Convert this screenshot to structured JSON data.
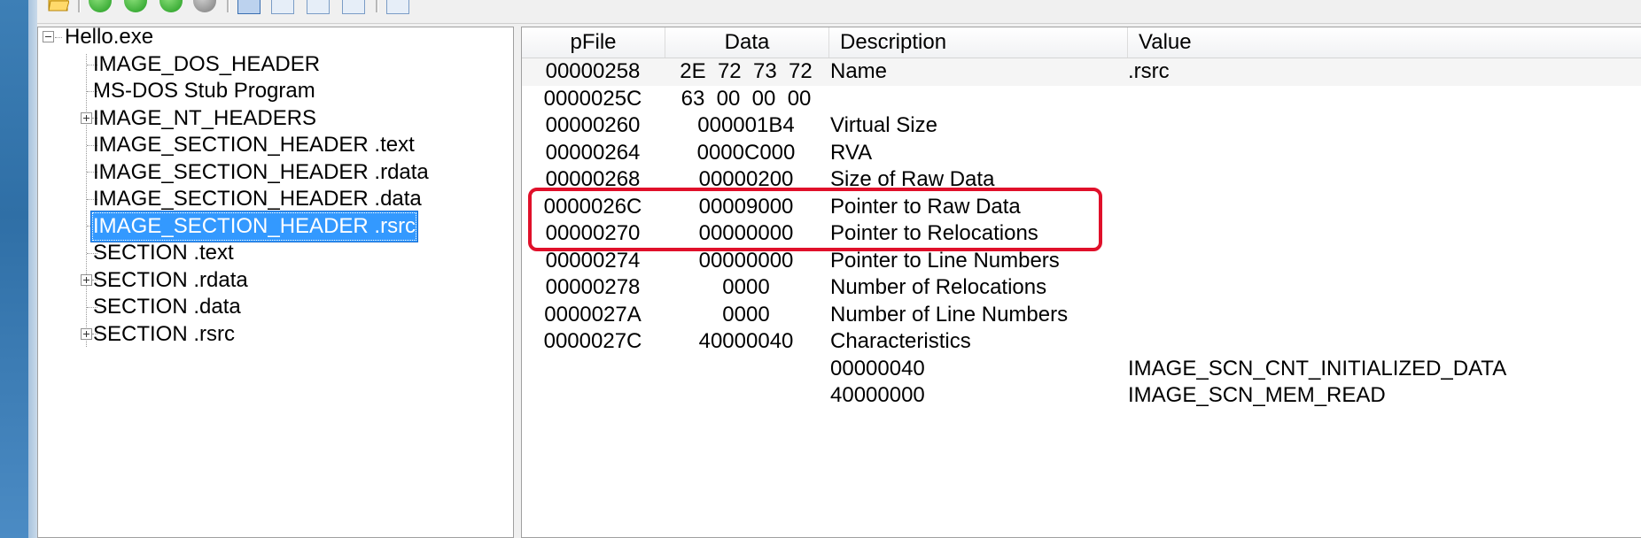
{
  "colors": {
    "accent_selection": "#3399ff",
    "highlight_border": "#e0102a"
  },
  "toolbar": {
    "icons": [
      "folder-open-icon",
      "green-go-icon",
      "green-forward-icon",
      "green-back-icon",
      "gray-stop-icon",
      "view-box-icon",
      "view-box-icon",
      "view-box-icon",
      "view-box-icon",
      "view-box-icon"
    ]
  },
  "tree": {
    "root": "Hello.exe",
    "items": [
      {
        "label": "IMAGE_DOS_HEADER",
        "expandable": false
      },
      {
        "label": "MS-DOS Stub Program",
        "expandable": false
      },
      {
        "label": "IMAGE_NT_HEADERS",
        "expandable": true
      },
      {
        "label": "IMAGE_SECTION_HEADER .text",
        "expandable": false
      },
      {
        "label": "IMAGE_SECTION_HEADER .rdata",
        "expandable": false
      },
      {
        "label": "IMAGE_SECTION_HEADER .data",
        "expandable": false
      },
      {
        "label": "IMAGE_SECTION_HEADER .rsrc",
        "expandable": false,
        "selected": true
      },
      {
        "label": "SECTION .text",
        "expandable": false
      },
      {
        "label": "SECTION .rdata",
        "expandable": true
      },
      {
        "label": "SECTION .data",
        "expandable": false
      },
      {
        "label": "SECTION .rsrc",
        "expandable": true
      }
    ]
  },
  "list": {
    "columns": [
      "pFile",
      "Data",
      "Description",
      "Value"
    ],
    "rows": [
      {
        "pfile": "00000258",
        "data": "2E  72  73  72",
        "desc": "Name",
        "value": ".rsrc"
      },
      {
        "pfile": "0000025C",
        "data": "63  00  00  00",
        "desc": "",
        "value": ""
      },
      {
        "pfile": "00000260",
        "data": "000001B4",
        "desc": "Virtual Size",
        "value": ""
      },
      {
        "pfile": "00000264",
        "data": "0000C000",
        "desc": "RVA",
        "value": ""
      },
      {
        "pfile": "00000268",
        "data": "00000200",
        "desc": "Size of Raw Data",
        "value": ""
      },
      {
        "pfile": "0000026C",
        "data": "00009000",
        "desc": "Pointer to Raw Data",
        "value": ""
      },
      {
        "pfile": "00000270",
        "data": "00000000",
        "desc": "Pointer to Relocations",
        "value": ""
      },
      {
        "pfile": "00000274",
        "data": "00000000",
        "desc": "Pointer to Line Numbers",
        "value": ""
      },
      {
        "pfile": "00000278",
        "data": "0000",
        "desc": "Number of Relocations",
        "value": ""
      },
      {
        "pfile": "0000027A",
        "data": "0000",
        "desc": "Number of Line Numbers",
        "value": ""
      },
      {
        "pfile": "0000027C",
        "data": "40000040",
        "desc": "Characteristics",
        "value": ""
      },
      {
        "pfile": "",
        "data": "",
        "desc": "00000040",
        "value": "IMAGE_SCN_CNT_INITIALIZED_DATA"
      },
      {
        "pfile": "",
        "data": "",
        "desc": "40000000",
        "value": "IMAGE_SCN_MEM_READ"
      }
    ]
  }
}
